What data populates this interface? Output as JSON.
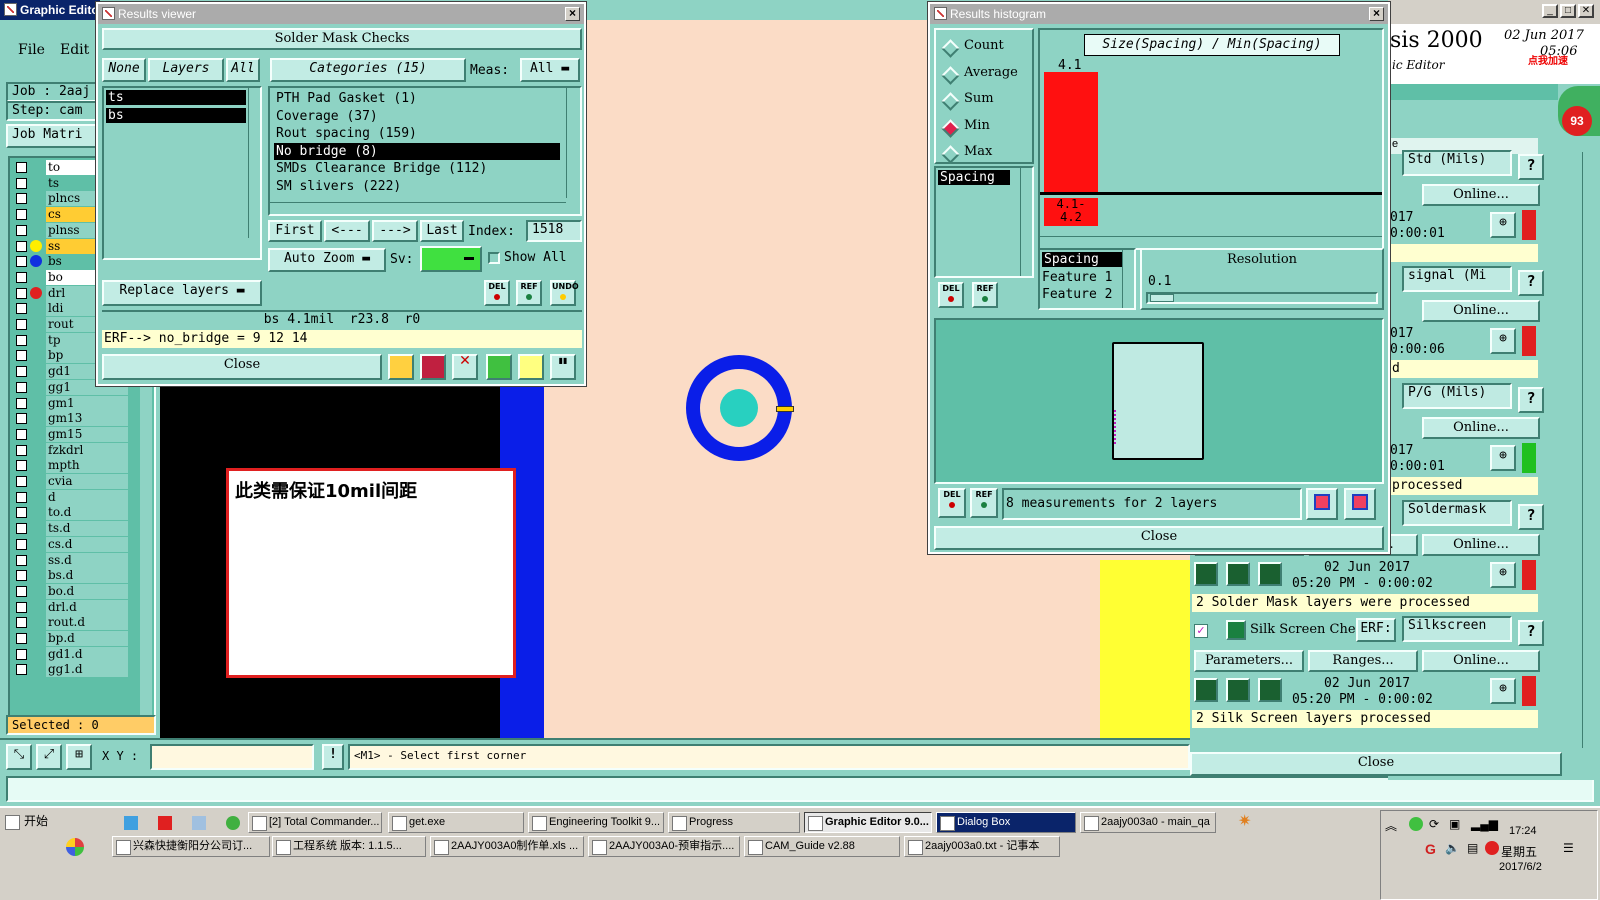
{
  "main_window": {
    "title": "Graphic Edito",
    "menu": [
      "File",
      "Edit"
    ],
    "job_label": "Job : 2aaj",
    "step_label": "Step: cam",
    "job_matrix_btn": "Job Matri",
    "selected": "Selected : 0",
    "xy_label": "X Y :",
    "status_message": "<M1> - Select first corner",
    "layers": [
      {
        "name": "to",
        "color": "#ffffff"
      },
      {
        "name": "ts",
        "color": "#5fbfa7"
      },
      {
        "name": "plncs",
        "color": "#8ed3c4"
      },
      {
        "name": "cs",
        "color": "#ffcc33"
      },
      {
        "name": "plnss",
        "color": "#8ed3c4"
      },
      {
        "name": "ss",
        "color": "#ffcc33"
      },
      {
        "name": "bs",
        "color": "#5fbfa7"
      },
      {
        "name": "bo",
        "color": "#ffffff"
      },
      {
        "name": "drl",
        "color": "#8ed3c4"
      },
      {
        "name": "ldi",
        "color": "#8ed3c4"
      },
      {
        "name": "rout",
        "color": "#8ed3c4"
      },
      {
        "name": "tp",
        "color": "#8ed3c4"
      },
      {
        "name": "bp",
        "color": "#8ed3c4"
      },
      {
        "name": "gd1",
        "color": "#8ed3c4"
      },
      {
        "name": "gg1",
        "color": "#8ed3c4"
      },
      {
        "name": "gm1",
        "color": "#8ed3c4"
      },
      {
        "name": "gm13",
        "color": "#8ed3c4"
      },
      {
        "name": "gm15",
        "color": "#8ed3c4"
      },
      {
        "name": "fzkdrl",
        "color": "#8ed3c4"
      },
      {
        "name": "mpth",
        "color": "#8ed3c4"
      },
      {
        "name": "cvia",
        "color": "#8ed3c4"
      },
      {
        "name": "d",
        "color": "#8ed3c4"
      },
      {
        "name": "to.d",
        "color": "#8ed3c4"
      },
      {
        "name": "ts.d",
        "color": "#8ed3c4"
      },
      {
        "name": "cs.d",
        "color": "#8ed3c4"
      },
      {
        "name": "ss.d",
        "color": "#8ed3c4"
      },
      {
        "name": "bs.d",
        "color": "#8ed3c4"
      },
      {
        "name": "bo.d",
        "color": "#8ed3c4"
      },
      {
        "name": "drl.d",
        "color": "#8ed3c4"
      },
      {
        "name": "rout.d",
        "color": "#8ed3c4"
      },
      {
        "name": "bp.d",
        "color": "#8ed3c4"
      },
      {
        "name": "gd1.d",
        "color": "#8ed3c4"
      },
      {
        "name": "gg1.d",
        "color": "#8ed3c4"
      }
    ]
  },
  "annotation_note": "此类需保证10mil间距",
  "results_viewer": {
    "title": "Results viewer",
    "header": "Solder Mask Checks",
    "none_btn": "None",
    "layers_btn": "Layers",
    "all_btn": "All",
    "categories_btn": "Categories (15)",
    "meas_label": "Meas:",
    "meas_value": "All",
    "layer_items": [
      "ts",
      "bs"
    ],
    "categories": [
      {
        "label": "PTH Pad Gasket (1)",
        "selected": false
      },
      {
        "label": "Coverage (37)",
        "selected": false
      },
      {
        "label": "Rout spacing (159)",
        "selected": false
      },
      {
        "label": "No bridge (8)",
        "selected": true
      },
      {
        "label": "SMDs Clearance Bridge (112)",
        "selected": false
      },
      {
        "label": "SM slivers (222)",
        "selected": false
      }
    ],
    "first_btn": "First",
    "prev_btn": "<---",
    "next_btn": "--->",
    "last_btn": "Last",
    "index_label": "Index:",
    "index_value": "1518",
    "auto_zoom": "Auto Zoom",
    "sv_label": "Sv:",
    "show_all": "Show All",
    "replace_layers": "Replace layers",
    "del": "DEL",
    "ref": "REF",
    "undo": "UNDO",
    "info_line": "bs 4.1mil  r23.8  r0",
    "erf_line": "ERF--> no_bridge = 9 12 14",
    "close": "Close"
  },
  "histogram": {
    "title": "Results histogram",
    "options": [
      {
        "label": "Count",
        "on": false
      },
      {
        "label": "Average",
        "on": false
      },
      {
        "label": "Sum",
        "on": false
      },
      {
        "label": "Min",
        "on": true
      },
      {
        "label": "Max",
        "on": false
      }
    ],
    "list_item": "Spacing",
    "chart_title": "Size(Spacing) / Min(Spacing)",
    "bar_value_label": "4.1",
    "bin_label": "4.1-\n4.2",
    "feature_items": [
      "Spacing",
      "Feature 1",
      "Feature 2"
    ],
    "resolution_label": "Resolution",
    "resolution_value": "0.1",
    "del": "DEL",
    "ref": "REF",
    "measurements": "8 measurements for 2 layers",
    "close": "Close"
  },
  "chart_data": {
    "type": "bar",
    "title": "Size(Spacing) / Min(Spacing)",
    "categories": [
      "4.1-4.2"
    ],
    "values": [
      4.1
    ]
  },
  "right_panel": {
    "title_fragment": "sis 2000",
    "subtitle": "ic Editor",
    "date": "02 Jun 2017",
    "time": "05:06",
    "badge": "93",
    "promo": "点我加速",
    "rows": [
      {
        "erf": "Std (Mils)",
        "online": "Online...",
        "date": "017",
        "time": "0:00:01",
        "msg": "",
        "status": "#e02020"
      },
      {
        "erf": "signal (Mi",
        "online": "Online...",
        "date": "017",
        "time": "0:00:06",
        "msg": "d",
        "status": "#e02020"
      },
      {
        "erf": "P/G (Mils)",
        "online": "Online...",
        "date": "017",
        "time": "0:00:01",
        "msg": "processed",
        "status": "#20c020"
      },
      {
        "erf": "Soldermask",
        "online": "Online...",
        "date": "02 Jun 2017",
        "time": "05:20 PM - 0:00:02",
        "msg": "2 Solder Mask layers were processed",
        "status": "#e02020",
        "params": "Parameters...",
        "ranges": "Ranges..."
      },
      {
        "erf": "Silkscreen",
        "online": "Online...",
        "date": "02 Jun 2017",
        "time": "05:20 PM - 0:00:02",
        "msg": "2 Silk Screen layers processed",
        "status": "#e02020",
        "params": "Parameters...",
        "ranges": "Ranges...",
        "name": "Silk Screen Che",
        "erf_label": "ERF:"
      }
    ],
    "close": "Close"
  },
  "taskbar": {
    "start": "开始",
    "row1": [
      "[2] Total Commander...",
      "get.exe",
      "Engineering Toolkit 9...",
      "Progress",
      "Graphic Editor 9.0...",
      "Dialog Box",
      "2aajy003a0 - main_qa"
    ],
    "row2": [
      "兴森快捷衡阳分公司订...",
      "工程系统  版本: 1.1.5...",
      "2AAJY003A0制作单.xls ...",
      "2AAJY003A0-预审指示....",
      "CAM_Guide v2.88",
      "2aajy003a0.txt - 记事本"
    ],
    "clock": "17:24",
    "weekday": "星期五",
    "date": "2017/6/2"
  }
}
